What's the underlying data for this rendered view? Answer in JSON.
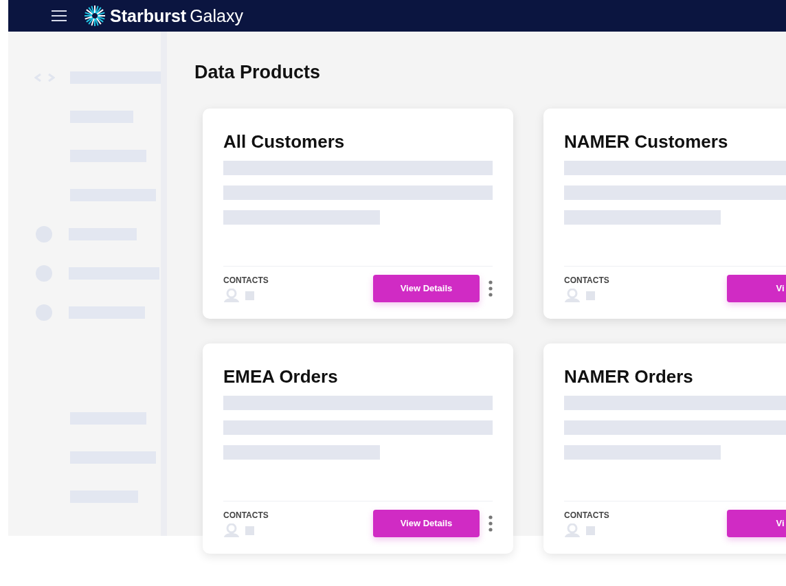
{
  "header": {
    "brand_name": "Starburst",
    "brand_product": "Galaxy"
  },
  "sidebar": {
    "items": [
      {
        "kind": "code"
      },
      {
        "kind": "plain"
      },
      {
        "kind": "plain"
      },
      {
        "kind": "plain"
      },
      {
        "kind": "dot"
      },
      {
        "kind": "dot"
      },
      {
        "kind": "dot"
      }
    ],
    "footer_items": [
      {
        "kind": "plain"
      },
      {
        "kind": "plain"
      },
      {
        "kind": "plain"
      }
    ]
  },
  "page": {
    "title": "Data Products"
  },
  "cards": [
    {
      "title": "All Customers",
      "contacts_label": "CONTACTS",
      "button": "View Details",
      "menu": true
    },
    {
      "title": "NAMER Customers",
      "contacts_label": "CONTACTS",
      "button": "Vi",
      "menu": false
    },
    {
      "title": "EMEA Orders",
      "contacts_label": "CONTACTS",
      "button": "View Details",
      "menu": true
    },
    {
      "title": "NAMER Orders",
      "contacts_label": "CONTACTS",
      "button": "Vi",
      "menu": false
    }
  ]
}
